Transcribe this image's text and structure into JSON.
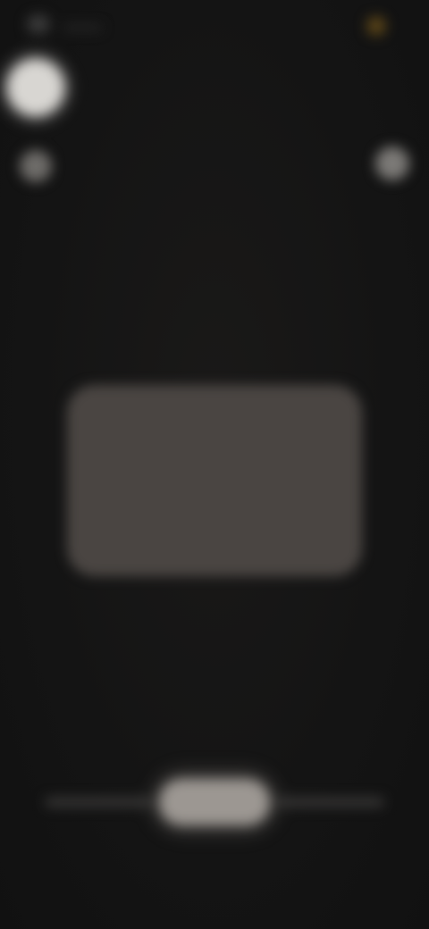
{
  "screen": {
    "background": "#141414"
  },
  "status_bar": {
    "left_icons": [
      "status-icon",
      "status-icon"
    ],
    "right_icon": "notification-icon",
    "right_icon_color": "#5a4418"
  },
  "top_controls": {
    "primary_icon": "circle-icon",
    "secondary_icon": "dot-icon",
    "right_icon": "dot-icon"
  },
  "card": {
    "color": "#4a4542"
  },
  "bottom_nav": {
    "handle_color": "#9c9792"
  }
}
